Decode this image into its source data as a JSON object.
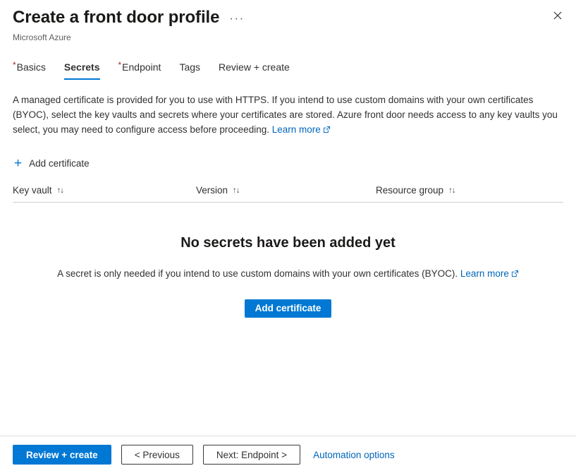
{
  "header": {
    "title": "Create a front door profile",
    "subtitle": "Microsoft Azure",
    "ellipsis_label": "···",
    "close_label": "Close"
  },
  "tabs": [
    {
      "label": "Basics",
      "required": true,
      "active": false
    },
    {
      "label": "Secrets",
      "required": false,
      "active": true
    },
    {
      "label": "Endpoint",
      "required": true,
      "active": false
    },
    {
      "label": "Tags",
      "required": false,
      "active": false
    },
    {
      "label": "Review + create",
      "required": false,
      "active": false
    }
  ],
  "description": {
    "text": "A managed certificate is provided for you to use with HTTPS. If you intend to use custom domains with your own certificates (BYOC), select the key vaults and secrets where your certificates are stored. Azure front door needs access to any key vaults you select, you may need to configure access before proceeding.",
    "learn_more": "Learn more"
  },
  "command_bar": {
    "add_certificate_label": "Add certificate",
    "plus_glyph": "+"
  },
  "table": {
    "columns": [
      {
        "label": "Key vault",
        "sort_glyph": "↑↓"
      },
      {
        "label": "Version",
        "sort_glyph": "↑↓"
      },
      {
        "label": "Resource group",
        "sort_glyph": "↑↓"
      }
    ],
    "rows": []
  },
  "empty_state": {
    "title": "No secrets have been added yet",
    "subtitle": "A secret is only needed if you intend to use custom domains with your own certificates (BYOC).",
    "learn_more": "Learn more",
    "button_label": "Add certificate"
  },
  "footer": {
    "review_create_label": "Review + create",
    "previous_label": "< Previous",
    "next_label": "Next: Endpoint >",
    "automation_label": "Automation options"
  },
  "colors": {
    "accent": "#0078d4",
    "link": "#0066bb",
    "required_star": "#a4262c",
    "text": "#323130",
    "divider": "#d2d0ce"
  }
}
